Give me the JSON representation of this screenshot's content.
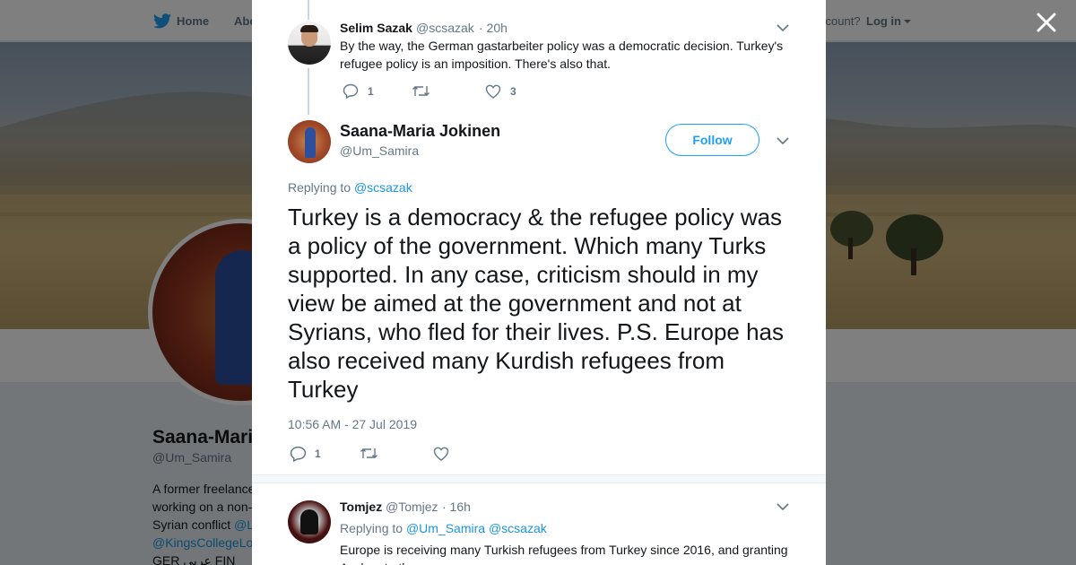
{
  "nav": {
    "home": "Home",
    "about": "Abo",
    "account_prompt": "ccount?",
    "login": "Log in"
  },
  "profile": {
    "name": "Saana-Mari",
    "handle": "@Um_Samira",
    "bio_line1": "A former freelance",
    "bio_line2": "working on a non-",
    "bio_line3_text": "Syrian conflict ",
    "bio_line3_link": "@L",
    "bio_line4_link": "@KingsCollegeLo",
    "bio_line5": "GER عربي FIN"
  },
  "parent_tweet": {
    "name": "Selim Sazak",
    "handle": "@scsazak",
    "time": "· 20h",
    "text": "By the way, the German gastarbeiter policy was a democratic decision. Turkey's refugee policy is an imposition. There's also that.",
    "replies": "1",
    "likes": "3"
  },
  "main_tweet": {
    "name": "Saana-Maria Jokinen",
    "handle": "@Um_Samira",
    "follow_label": "Follow",
    "replying_label": "Replying to ",
    "replying_to": "@scsazak",
    "text": "Turkey is a democracy & the refugee policy was a policy of the government. Which many Turks supported. In any case, criticism should in my view be aimed at the government and not at Syrians, who fled for their lives. P.S. Europe has also received many Kurdish refugees from Turkey",
    "timestamp": "10:56 AM - 27 Jul 2019",
    "replies": "1"
  },
  "reply_tweet": {
    "name": "Tomjez",
    "handle": "@Tomjez",
    "time": "· 16h",
    "replying_label": "Replying to ",
    "replying_to_1": "@Um_Samira",
    "replying_to_2": "@scsazak",
    "text": "Europe is receiving many Turkish refugees from Turkey since 2016, and granting Asylum to them..."
  },
  "colors": {
    "accent": "#1da1f2",
    "link": "#1b95e0",
    "text": "#14171a",
    "muted": "#657786"
  }
}
